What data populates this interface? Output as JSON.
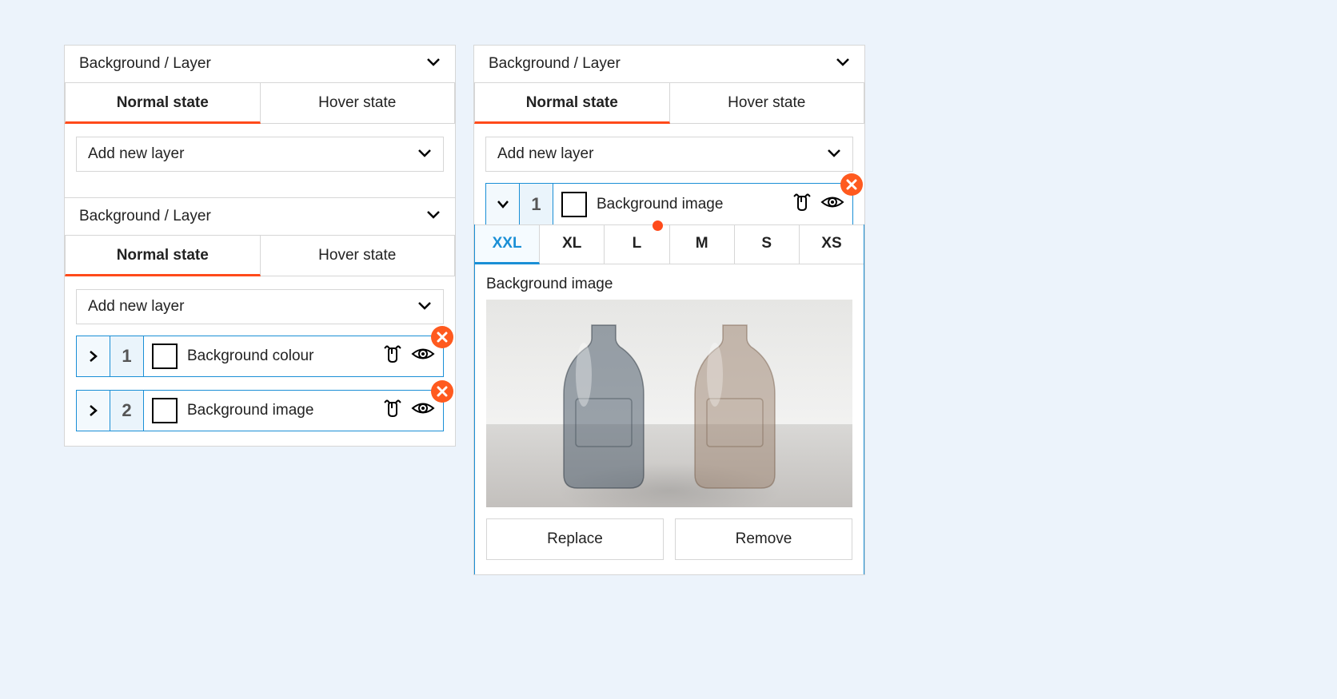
{
  "left": {
    "header1": "Background / Layer",
    "tabs": {
      "normal": "Normal state",
      "hover": "Hover state"
    },
    "add1": "Add new layer",
    "header2": "Background / Layer",
    "add2": "Add new layer",
    "layers": [
      {
        "num": "1",
        "label": "Background colour"
      },
      {
        "num": "2",
        "label": "Background image"
      }
    ]
  },
  "right": {
    "header": "Background / Layer",
    "tabs": {
      "normal": "Normal state",
      "hover": "Hover state"
    },
    "add": "Add new layer",
    "layer": {
      "num": "1",
      "label": "Background image"
    },
    "breakpoints": [
      "XXL",
      "XL",
      "L",
      "M",
      "S",
      "XS"
    ],
    "activeBreakpoint": "XXL",
    "dotBreakpoint": "L",
    "bgImageLabel": "Background image",
    "replace": "Replace",
    "remove": "Remove"
  }
}
